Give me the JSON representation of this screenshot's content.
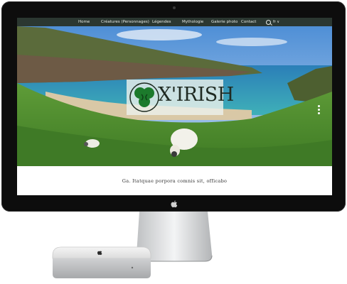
{
  "nav": {
    "items": [
      "Home",
      "Créatures (Personnages)",
      "Légendes",
      "Mythologie",
      "Galerie photo",
      "Contact"
    ],
    "lang": "fr ∨"
  },
  "logo": {
    "text": "X'IRISH"
  },
  "tagline": "Ga. Itatquae porpora comnis sit, officabo",
  "colors": {
    "nav_bg": "#2b3731",
    "grass": "#4f8a2e",
    "sea": "#2a8fb0",
    "logo_green": "#1c7a2c"
  },
  "icons": {
    "search": "search-icon",
    "apple": "apple-logo-icon",
    "shamrock": "shamrock-icon"
  }
}
